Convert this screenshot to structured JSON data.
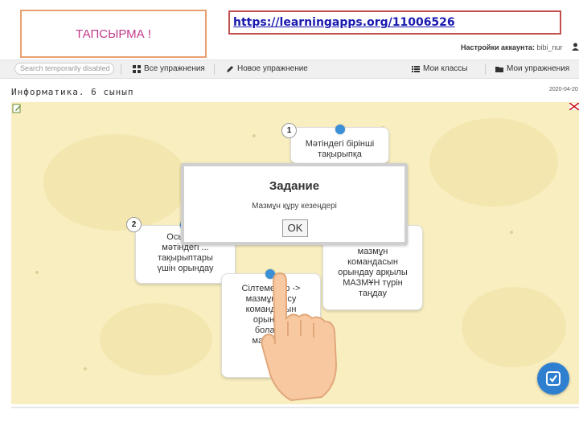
{
  "callouts": {
    "task_label": "ТАПСЫРМА !",
    "url": "https://learningapps.org/11006526"
  },
  "account": {
    "label": "Настройки аккаунта:",
    "username": "bibi_nur"
  },
  "nav": {
    "search_placeholder": "Search temporarily disabled",
    "items": [
      {
        "label": "Все упражнения",
        "icon": "grid-icon"
      },
      {
        "label": "Новое упражнение",
        "icon": "pencil-icon"
      },
      {
        "label": "Мои классы",
        "icon": "list-icon"
      },
      {
        "label": "Мои упражнения",
        "icon": "folder-icon"
      }
    ]
  },
  "page": {
    "title": "Информатика. 6 сынып",
    "date": "2020-04-20"
  },
  "cards": [
    {
      "number": "1",
      "lines": [
        "Мәтіндегі бірінші",
        "тақырыпқа"
      ]
    },
    {
      "number": "2",
      "lines": [
        "Осы әр...",
        "мәтіндегі ...",
        "тақырыптары",
        "үшін орындау"
      ]
    },
    {
      "lines": [
        "мазмұн",
        "командасын",
        "орындау арқылы",
        "МАЗМҰН түрін",
        "таңдау"
      ]
    },
    {
      "lines": [
        "Сілтемелер ->",
        "мазмұн қосу",
        "командасын",
        "орындау",
        "болад...",
        "мазмұн...",
        "",
        "м..."
      ]
    }
  ],
  "modal": {
    "title": "Задание",
    "message": "Мазмұн құру кезеңдері",
    "ok_label": "OK"
  },
  "colors": {
    "accent": "#3a8fd6",
    "background": "#f8eec0",
    "task_text": "#c0398a"
  }
}
